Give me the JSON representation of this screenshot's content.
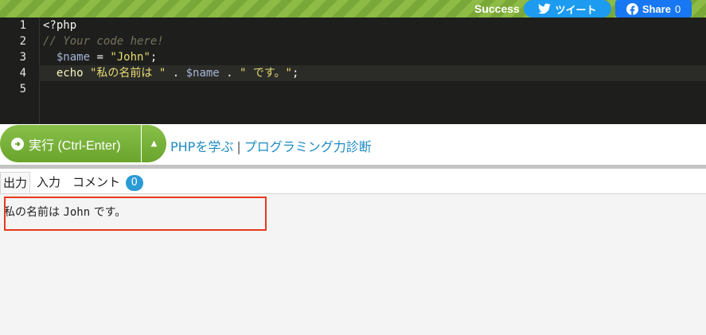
{
  "header": {
    "status": "Success",
    "tweet_label": "ツイート",
    "share_label": "Share",
    "share_count": "0"
  },
  "editor": {
    "line_numbers": [
      "1",
      "2",
      "3",
      "4",
      "5"
    ],
    "lines": {
      "l1": "<?php",
      "l2": "// Your code here!",
      "l3_var": "$name",
      "l3_op": " = ",
      "l3_str": "\"John\"",
      "l3_end": ";",
      "l4_kw": "echo",
      "l4_str1": " \"私の名前は \"",
      "l4_op1": " . ",
      "l4_var": "$name",
      "l4_op2": " . ",
      "l4_str2": "\" です。\"",
      "l4_end": ";"
    }
  },
  "toolbar": {
    "run_label": "実行 (Ctrl-Enter)",
    "link_learn": "PHPを学ぶ",
    "link_separator": "|",
    "link_diagnosis": "プログラミング力診断"
  },
  "tabs": {
    "output": "出力",
    "input": "入力",
    "comments": "コメント",
    "comment_count": "0"
  },
  "output": {
    "part1": "私の名前は ",
    "name": "John",
    "part2": " です。"
  },
  "colors": {
    "accent_green": "#7ab23c",
    "link_blue": "#1e8bc3",
    "highlight_red": "#e8391f"
  }
}
